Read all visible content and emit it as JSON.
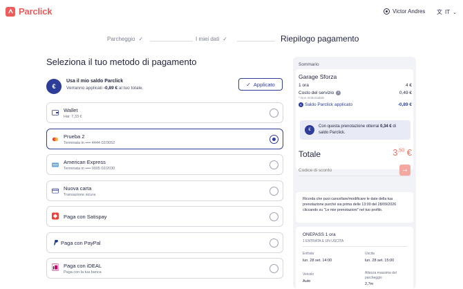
{
  "header": {
    "brand": "Parclick",
    "user_name": "Victor Andres",
    "lang": "IT"
  },
  "stepper": {
    "steps": [
      {
        "label": "Parcheggio",
        "done": true
      },
      {
        "label": "I miei dati",
        "done": true
      },
      {
        "label": "Riepilogo pagamento",
        "done": false,
        "current": true
      }
    ]
  },
  "left": {
    "title": "Seleziona il tuo metodo di pagamento",
    "saldo": {
      "title": "Usa il mio saldo Parclick",
      "sub_prefix": "Verranno applicati ",
      "sub_amount": "-0,89 €",
      "sub_suffix": " al tuo totale.",
      "button_label": "Applicato"
    },
    "methods": [
      {
        "name": "Wallet",
        "sub": "Hai:  7,33 €",
        "selected": false,
        "icon": "wallet-icon"
      },
      {
        "name": "Prueba 2",
        "sub": "Terminata in •••• 4444   02/3052",
        "selected": true,
        "icon": "mastercard-icon"
      },
      {
        "name": "American Express",
        "sub": "Terminata in •••• 0005   02/2030",
        "selected": false,
        "icon": "amex-icon"
      },
      {
        "name": "Nuova carta",
        "sub": "Transazione sicura",
        "selected": false,
        "icon": "card-icon"
      },
      {
        "name": "Paga con Satispay",
        "sub": "",
        "selected": false,
        "icon": "satispay-icon"
      },
      {
        "name": "Paga con PayPal",
        "sub": "",
        "selected": false,
        "icon": "paypal-icon"
      },
      {
        "name": "Paga con iDEAL",
        "sub": "Paga con la tua banca",
        "selected": false,
        "icon": "ideal-icon"
      }
    ]
  },
  "summary": {
    "label": "Sommario",
    "garage": "Garage Sforza",
    "rows": [
      {
        "label": "1 ora",
        "value": "4 €"
      },
      {
        "label": "Costo del servizio",
        "value": "0,49 €",
        "sub": "* Non rimborsabile"
      },
      {
        "label": "Saldo Parclick applicato",
        "value": "-0,89 €"
      }
    ],
    "promo_prefix": "Con questa prenotazione otterrai ",
    "promo_amount": "0,34 €",
    "promo_suffix": " di saldo Parclick.",
    "total_label": "Totale",
    "total_main": "3",
    "total_cents": ",50",
    "total_currency": " €",
    "discount_placeholder": "Codice di sconto",
    "notice": "Ricorda che puoi cancellare/modificare le date della tua prenotazione purché sia prima delle 13:00 del 28/09/2026 cliccando su \"Le mie prenotazioni\" nel tuo profilo.",
    "pass": {
      "title": "ONEPASS 1 ora",
      "sub": "1 ENTRATA E UN USCITA",
      "entrata_label": "Entrata",
      "entrata_value": "lun. 28 set. 14:00",
      "uscita_label": "Uscita",
      "uscita_value": "lun. 28 set. 15:00",
      "veicolo_label": "Veicolo",
      "veicolo_value": "Auto",
      "altezza_label": "Altezza massima del parcheggio",
      "altezza_value": "2,7m"
    }
  },
  "colors": {
    "brand": "#ef5c5c",
    "accent": "#2e3d9a",
    "total": "#ef7060"
  }
}
